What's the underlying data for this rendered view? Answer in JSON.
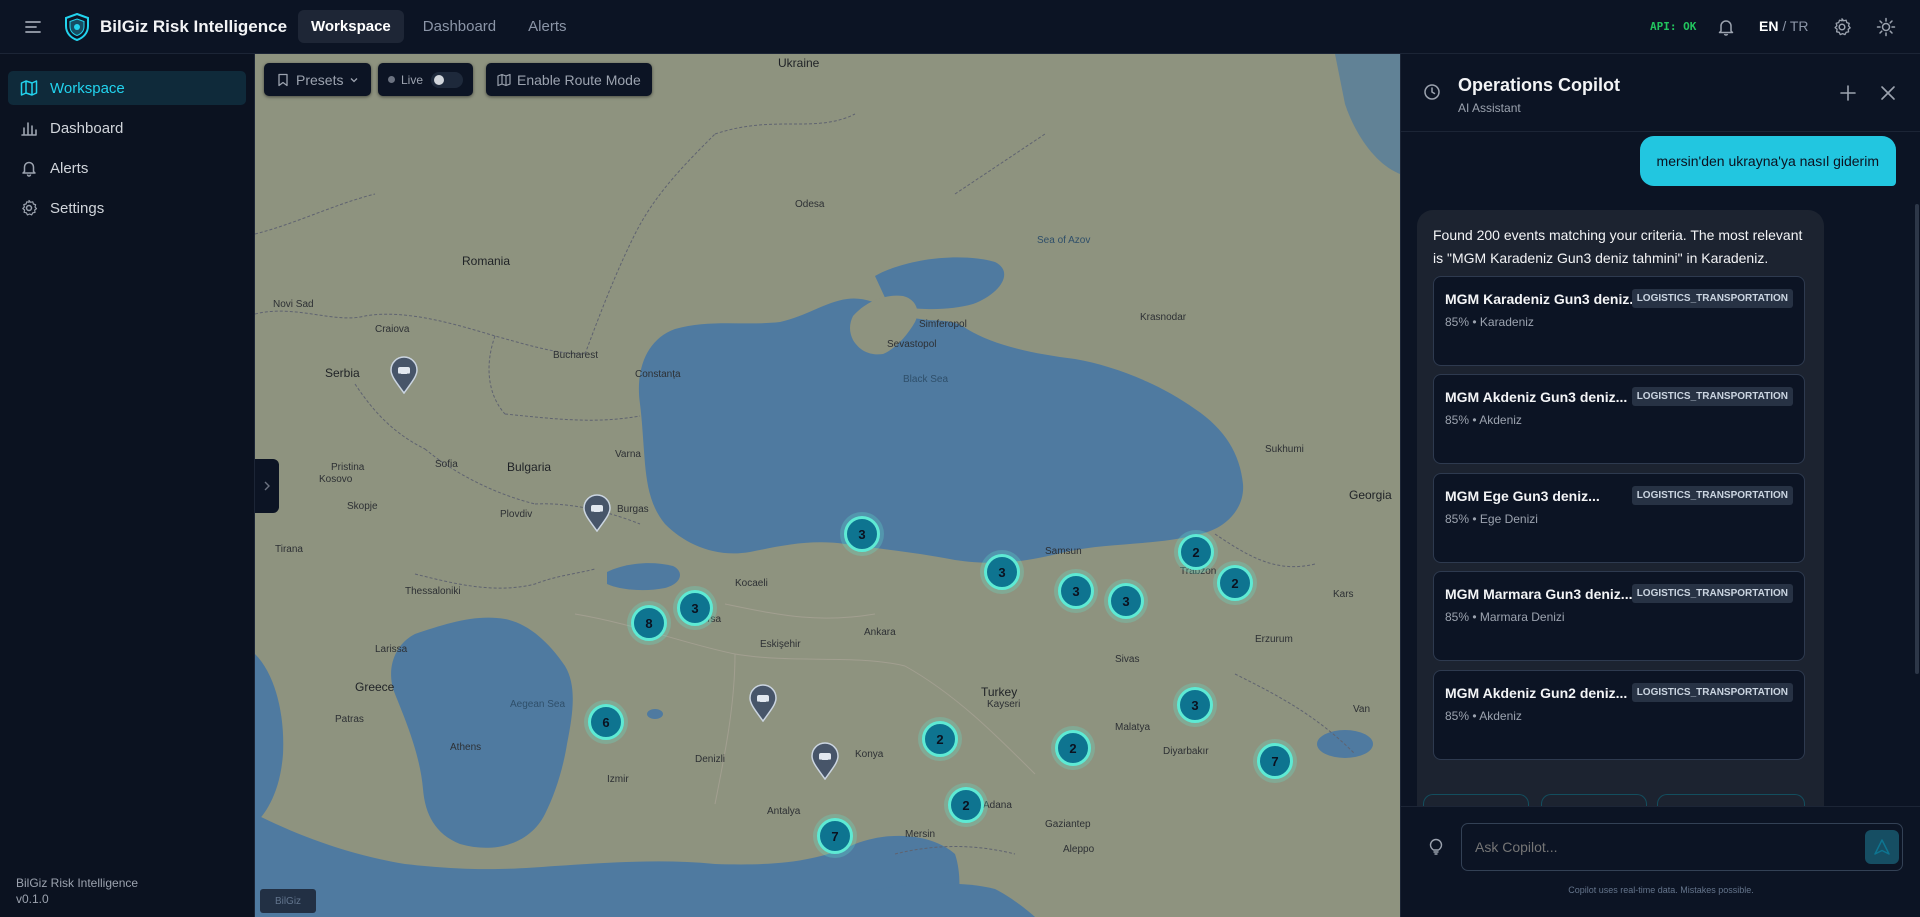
{
  "app": {
    "brand": "BilGiz Risk Intelligence",
    "nav_tabs": [
      {
        "label": "Workspace",
        "active": true
      },
      {
        "label": "Dashboard",
        "active": false
      },
      {
        "label": "Alerts",
        "active": false
      }
    ],
    "api_status": "API: OK",
    "lang_active": "EN",
    "lang_sep": "/",
    "lang_other": "TR",
    "accent_color": "#22d3ee",
    "status_color": "#22c55e"
  },
  "sidebar": {
    "items": [
      {
        "label": "Workspace",
        "icon": "map-icon",
        "active": true
      },
      {
        "label": "Dashboard",
        "icon": "bar-chart-icon",
        "active": false
      },
      {
        "label": "Alerts",
        "icon": "bell-icon",
        "active": false
      },
      {
        "label": "Settings",
        "icon": "gear-icon",
        "active": false
      }
    ],
    "footer_name": "BilGiz Risk Intelligence",
    "footer_version": "v0.1.0"
  },
  "map": {
    "presets_label": "Presets",
    "live_label": "Live",
    "route_mode_label": "Enable Route Mode",
    "attribution": "BilGiz",
    "labels": {
      "ukraine": "Ukraine",
      "romania": "Romania",
      "serbia": "Serbia",
      "bulgaria": "Bulgaria",
      "greece": "Greece",
      "turkey": "Turkey",
      "georgia": "Georgia",
      "black_sea": "Black Sea",
      "aegean_sea": "Aegean Sea",
      "sea_of_azov": "Sea of Azov",
      "bucharest": "Bucharest",
      "sofia": "Sofia",
      "skopje": "Skopje",
      "athens": "Athens",
      "ankara": "Ankara",
      "tirana": "Tirana",
      "kosovo": "Kosovo",
      "pristina": "Pristina",
      "novi_sad": "Novi Sad",
      "thessaloniki": "Thessaloniki",
      "plovdiv": "Plovdiv",
      "varna": "Varna",
      "constanta": "Constanța",
      "sevastopol": "Sevastopol",
      "simferopol": "Simferopol",
      "izmir": "Izmir",
      "antalya": "Antalya",
      "samsun": "Samsun",
      "trabzon": "Trabzon",
      "erzurum": "Erzurum",
      "kayseri": "Kayseri",
      "adana": "Adana",
      "aleppo": "Aleppo",
      "van": "Van",
      "konya": "Konya",
      "kars": "Kars",
      "craiova": "Craiova",
      "burgas": "Burgas",
      "odesa": "Odesa",
      "krasnodar": "Krasnodar",
      "sukhumi": "Sukhumi",
      "bursa": "Bursa",
      "eskisehir": "Eskişehir",
      "kocaeli": "Kocaeli",
      "sivas": "Sivas",
      "malatya": "Malatya",
      "diyarbakir": "Diyarbakır",
      "gaziantep": "Gaziantep",
      "mersin": "Mersin",
      "denizli": "Denizli",
      "patras": "Patras",
      "larissa": "Larissa"
    },
    "clusters": [
      {
        "count": "3",
        "name": "cluster-marmara"
      },
      {
        "count": "8",
        "name": "cluster-istanbul"
      },
      {
        "count": "3",
        "name": "cluster-zonguldak"
      },
      {
        "count": "3",
        "name": "cluster-samsun"
      },
      {
        "count": "3",
        "name": "cluster-ordu"
      },
      {
        "count": "3",
        "name": "cluster-trabzon"
      },
      {
        "count": "2",
        "name": "cluster-batumi"
      },
      {
        "count": "2",
        "name": "cluster-kars"
      },
      {
        "count": "6",
        "name": "cluster-izmir"
      },
      {
        "count": "3",
        "name": "cluster-erzurum"
      },
      {
        "count": "2",
        "name": "cluster-kayseri"
      },
      {
        "count": "2",
        "name": "cluster-malatya"
      },
      {
        "count": "7",
        "name": "cluster-van"
      },
      {
        "count": "2",
        "name": "cluster-adana"
      },
      {
        "count": "7",
        "name": "cluster-antalya"
      }
    ]
  },
  "copilot": {
    "title": "Operations Copilot",
    "subtitle": "AI Assistant",
    "user_message": "mersin'den ukrayna'ya nasıl giderim",
    "bot_message": "Found 200 events matching your criteria. The most relevant is \"MGM Karadeniz Gun3 deniz tahmini\" in Karadeniz.",
    "events": [
      {
        "title": "MGM Karadeniz Gun3 deniz...",
        "badge": "LOGISTICS_TRANSPORTATION",
        "meta": "85% • Karadeniz"
      },
      {
        "title": "MGM Akdeniz Gun3 deniz...",
        "badge": "LOGISTICS_TRANSPORTATION",
        "meta": "85% • Akdeniz"
      },
      {
        "title": "MGM Ege Gun3 deniz...",
        "badge": "LOGISTICS_TRANSPORTATION",
        "meta": "85% • Ege Denizi"
      },
      {
        "title": "MGM Marmara Gun3 deniz...",
        "badge": "LOGISTICS_TRANSPORTATION",
        "meta": "85% • Marmara Denizi"
      },
      {
        "title": "MGM Akdeniz Gun2 deniz...",
        "badge": "LOGISTICS_TRANSPORTATION",
        "meta": "85% • Akdeniz"
      }
    ],
    "input_placeholder": "Ask Copilot...",
    "disclaimer": "Copilot uses real-time data. Mistakes possible."
  }
}
